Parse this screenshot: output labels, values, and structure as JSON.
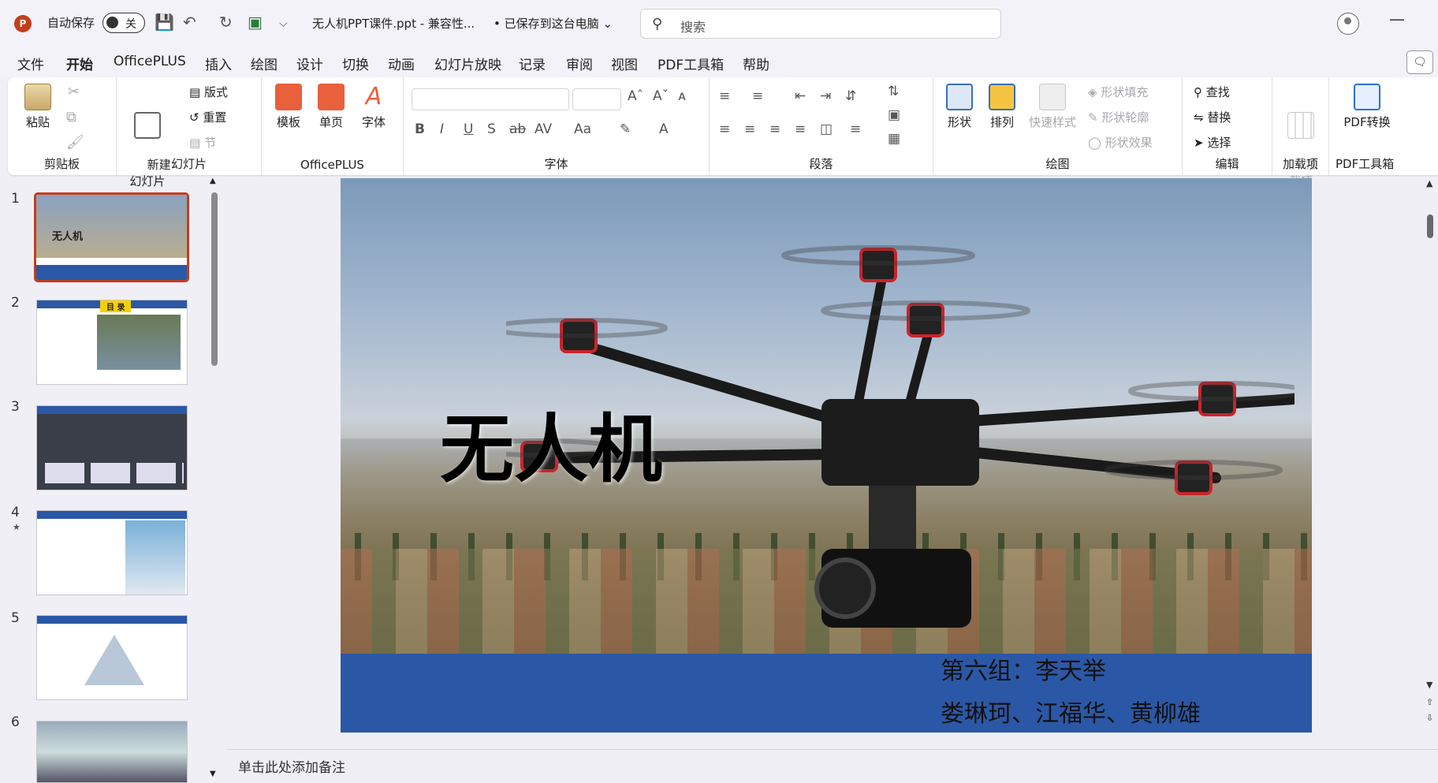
{
  "titlebar": {
    "app_icon": "P",
    "autosave_label": "自动保存",
    "toggle_state": "关",
    "doc_title": "无人机PPT课件.ppt  -  兼容性...",
    "saved_status": "• 已保存到这台电脑 ⌄",
    "search_placeholder": "搜索",
    "minimize": "—"
  },
  "menu": {
    "tabs": [
      "文件",
      "开始",
      "OfficePLUS",
      "插入",
      "绘图",
      "设计",
      "切换",
      "动画",
      "幻灯片放映",
      "记录",
      "审阅",
      "视图",
      "PDF工具箱",
      "帮助"
    ],
    "active": "开始"
  },
  "ribbon": {
    "clipboard": {
      "paste": "粘贴",
      "label": "剪贴板"
    },
    "slides": {
      "new_slide": "新建\n幻灯片",
      "layout": "版式",
      "reset": "重置",
      "section": "节",
      "label": "幻灯片"
    },
    "officeplus": {
      "template": "模板",
      "single": "单页",
      "font": "字体",
      "label": "OfficePLUS"
    },
    "font": {
      "label": "字体",
      "bold": "B",
      "italic": "I",
      "underline": "U",
      "shadow": "S",
      "strike": "ab",
      "spacing": "AV",
      "case": "Aa"
    },
    "paragraph": {
      "label": "段落"
    },
    "drawing": {
      "shape": "形状",
      "arrange": "排列",
      "quick_style": "快速样式",
      "fill": "形状填充",
      "outline": "形状轮廓",
      "effect": "形状效果",
      "label": "绘图"
    },
    "editing": {
      "find": "查找",
      "replace": "替换",
      "select": "选择",
      "label": "编辑"
    },
    "addins": {
      "addin": "加\n载项",
      "label": "加载项"
    },
    "pdf": {
      "convert": "PDF转换",
      "label": "PDF工具箱"
    }
  },
  "thumbnails": [
    {
      "num": "1",
      "title": "无人机"
    },
    {
      "num": "2",
      "title": "目 录"
    },
    {
      "num": "3",
      "title": ""
    },
    {
      "num": "4",
      "title": ""
    },
    {
      "num": "5",
      "title": ""
    },
    {
      "num": "6",
      "title": ""
    }
  ],
  "slide": {
    "title": "无人机",
    "names_line1": "第六组：李天举",
    "names_line2": "娄琳珂、江福华、黄柳雄"
  },
  "notes_placeholder": "单击此处添加备注",
  "colors": {
    "accent": "#c43e1c",
    "band": "#2b58a6"
  }
}
